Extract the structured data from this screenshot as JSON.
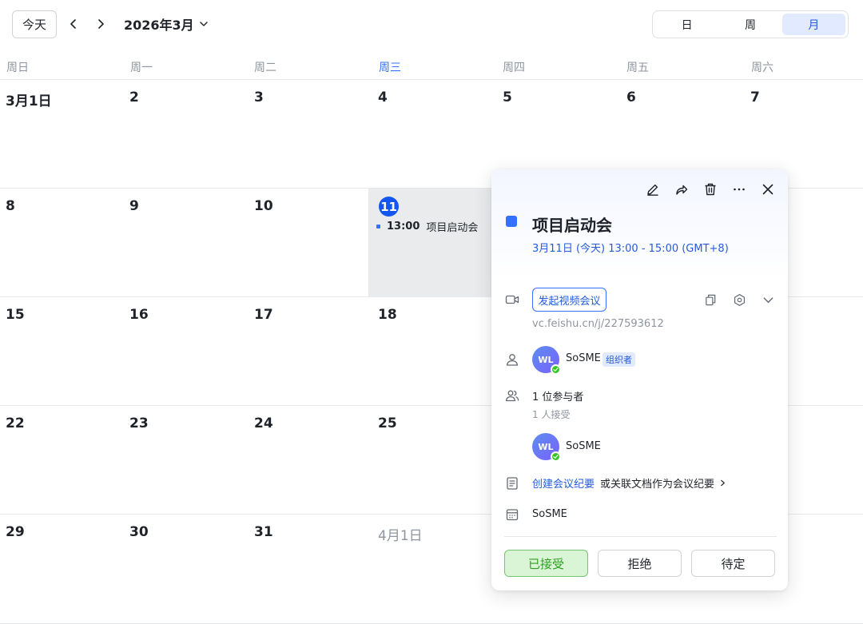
{
  "toolbar": {
    "today_label": "今天",
    "month_label": "2026年3月",
    "views": [
      "日",
      "周",
      "月"
    ],
    "active_view": "月"
  },
  "weekdays": [
    "周日",
    "周一",
    "周二",
    "周三",
    "周四",
    "周五",
    "周六"
  ],
  "current_weekday": "周三",
  "weeks": [
    [
      "3月1日",
      "2",
      "3",
      "4",
      "5",
      "6",
      "7"
    ],
    [
      "8",
      "9",
      "10",
      "11",
      "",
      "",
      ""
    ],
    [
      "15",
      "16",
      "17",
      "18",
      "",
      "",
      ""
    ],
    [
      "22",
      "23",
      "24",
      "25",
      "",
      "",
      ""
    ],
    [
      "29",
      "30",
      "31",
      "4月1日",
      "",
      "",
      ""
    ]
  ],
  "today_cell": {
    "day": "11",
    "event_time": "13:00",
    "event_title": "项目启动会"
  },
  "event": {
    "title": "项目启动会",
    "time": "3月11日 (今天) 13:00 - 15:00 (GMT+8)",
    "color": "#3370ff",
    "video_button": "发起视频会议",
    "video_link": "vc.feishu.cn/j/227593612",
    "organizer": {
      "initials": "WL",
      "name": "SoSME",
      "badge": "组织者"
    },
    "attendees_count": "1 位参与者",
    "accepted_count": "1 人接受",
    "attendee": {
      "initials": "WL",
      "name": "SoSME"
    },
    "notes_link": "创建会议纪要",
    "notes_alt": "或关联文档作为会议纪要",
    "calendar_name": "SoSME",
    "responses": {
      "accept": "已接受",
      "decline": "拒绝",
      "tentative": "待定"
    }
  },
  "icons": {
    "header_actions": [
      "edit-icon",
      "share-icon",
      "delete-icon",
      "more-icon",
      "close-icon"
    ],
    "video_tools": [
      "copy-icon",
      "settings-icon",
      "chevron-down-icon"
    ]
  }
}
